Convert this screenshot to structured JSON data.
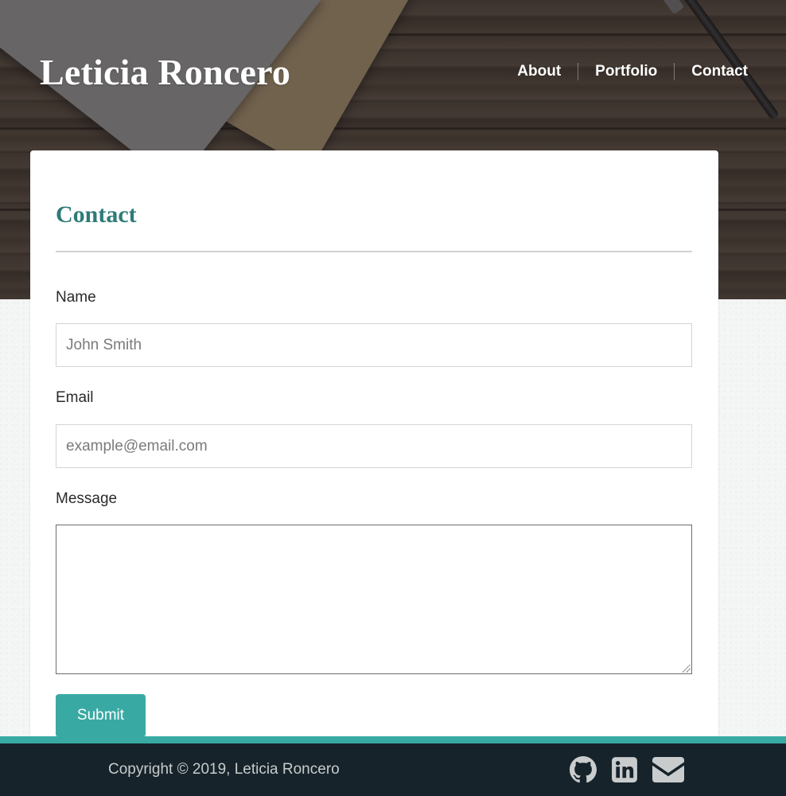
{
  "header": {
    "site_title": "Leticia Roncero",
    "nav": [
      {
        "label": "About"
      },
      {
        "label": "Portfolio"
      },
      {
        "label": "Contact"
      }
    ]
  },
  "contact_form": {
    "heading": "Contact",
    "name_label": "Name",
    "name_placeholder": "John Smith",
    "email_label": "Email",
    "email_placeholder": "example@email.com",
    "message_label": "Message",
    "message_value": "",
    "submit_label": "Submit"
  },
  "footer": {
    "copyright": "Copyright © 2019, Leticia Roncero",
    "social_icons": [
      "github-icon",
      "linkedin-icon",
      "envelope-icon"
    ]
  },
  "colors": {
    "accent": "#38aaa3",
    "heading": "#2e7b78",
    "footer_bg": "#16232a"
  }
}
